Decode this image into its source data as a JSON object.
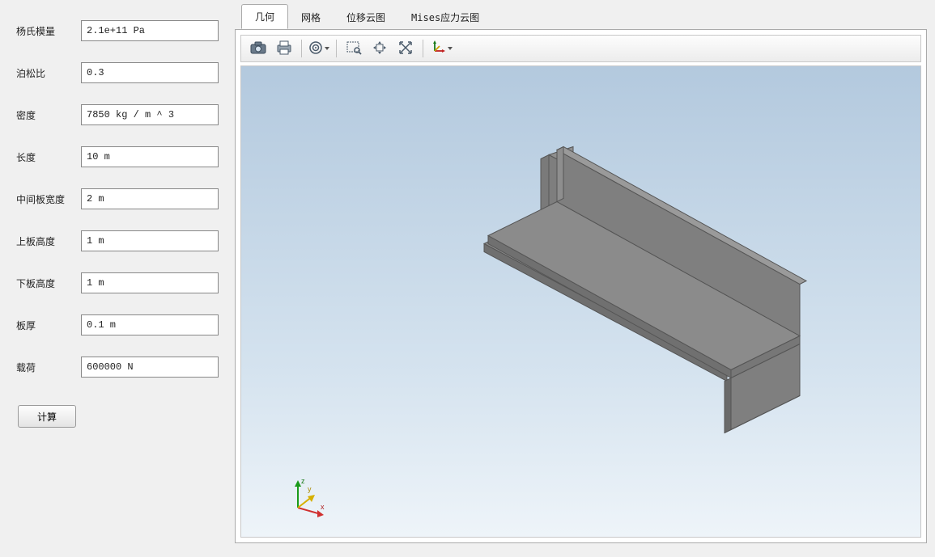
{
  "sidebar": {
    "fields": {
      "youngs_modulus": {
        "label": "杨氏模量",
        "value": "2.1e+11 Pa"
      },
      "poisson_ratio": {
        "label": "泊松比",
        "value": "0.3"
      },
      "density": {
        "label": "密度",
        "value": "7850 kg / m ^ 3"
      },
      "length": {
        "label": "长度",
        "value": "10 m"
      },
      "mid_plate_width": {
        "label": "中间板宽度",
        "value": "2 m"
      },
      "top_plate_height": {
        "label": "上板高度",
        "value": "1 m"
      },
      "bottom_plate_height": {
        "label": "下板高度",
        "value": "1 m"
      },
      "thickness": {
        "label": "板厚",
        "value": "0.1 m"
      },
      "load": {
        "label": "载荷",
        "value": "600000 N"
      }
    },
    "calc_button": "计算"
  },
  "tabs": {
    "geometry": "几何",
    "mesh": "网格",
    "displacement": "位移云图",
    "mises": "Mises应力云图",
    "active": "geometry"
  },
  "toolbar": {
    "snapshot": "snapshot-icon",
    "print": "print-icon",
    "reset": "reset-icon",
    "zoom_window": "zoom-window-icon",
    "pan": "pan-icon",
    "zoom_extents": "zoom-extents-icon",
    "axes": "axes-icon"
  },
  "triad": {
    "x": "x",
    "y": "y",
    "z": "z"
  }
}
